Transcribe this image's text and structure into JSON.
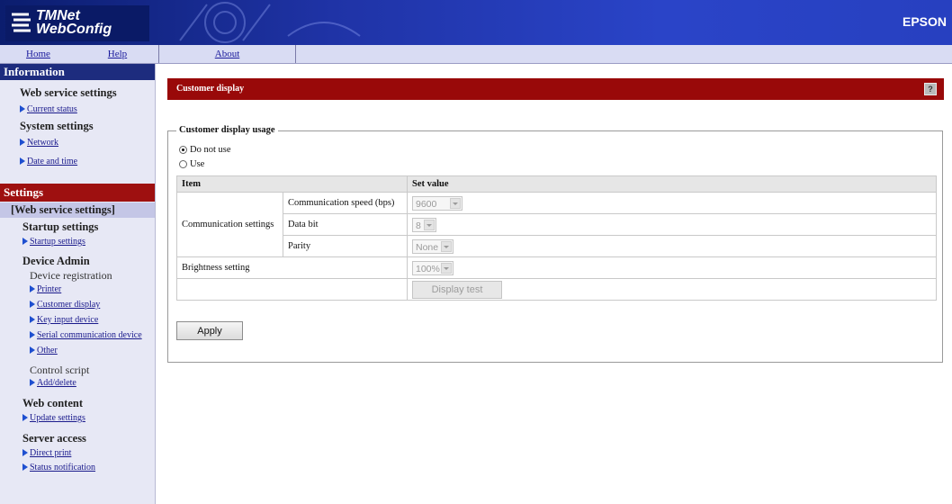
{
  "header": {
    "logo_line1": "TMNet",
    "logo_line2": "WebConfig",
    "brand": "EPSON"
  },
  "nav": {
    "home": "Home",
    "help": "Help",
    "about": "About"
  },
  "sidebar": {
    "information": {
      "title": "Information",
      "web_service_heading": "Web service settings",
      "current_status": "Current status",
      "system_heading": "System settings",
      "network": "Network",
      "date_time": "Date and time"
    },
    "settings": {
      "title": "Settings",
      "current_section": "[Web service settings]",
      "startup_heading": "Startup settings",
      "startup_link": "Startup settings",
      "device_admin_heading": "Device Admin",
      "device_registration": "Device registration",
      "printer": "Printer",
      "customer_display": "Customer display",
      "key_input": "Key input device",
      "serial_comm": "Serial communication device",
      "other": "Other",
      "control_script": "Control script",
      "add_delete": "Add/delete",
      "web_content_heading": "Web content",
      "update_settings": "Update settings",
      "server_access_heading": "Server access",
      "direct_print": "Direct print",
      "status_notification": "Status notification"
    }
  },
  "main": {
    "title": "Customer display",
    "help_icon": "?",
    "usage_legend": "Customer display usage",
    "radio_do_not_use": "Do not use",
    "radio_use": "Use",
    "selected_usage": "Do not use",
    "table": {
      "header_item": "Item",
      "header_value": "Set value",
      "comm_settings": "Communication settings",
      "comm_speed_label": "Communication speed (bps)",
      "comm_speed_value": "9600",
      "data_bit_label": "Data bit",
      "data_bit_value": "8",
      "parity_label": "Parity",
      "parity_value": "None",
      "brightness_label": "Brightness setting",
      "brightness_value": "100%",
      "display_test": "Display test"
    },
    "apply": "Apply"
  },
  "colors": {
    "header_blue": "#1f33a6",
    "info_bar": "#1d2c7e",
    "settings_bar": "#9e1010",
    "title_bar": "#990909"
  }
}
